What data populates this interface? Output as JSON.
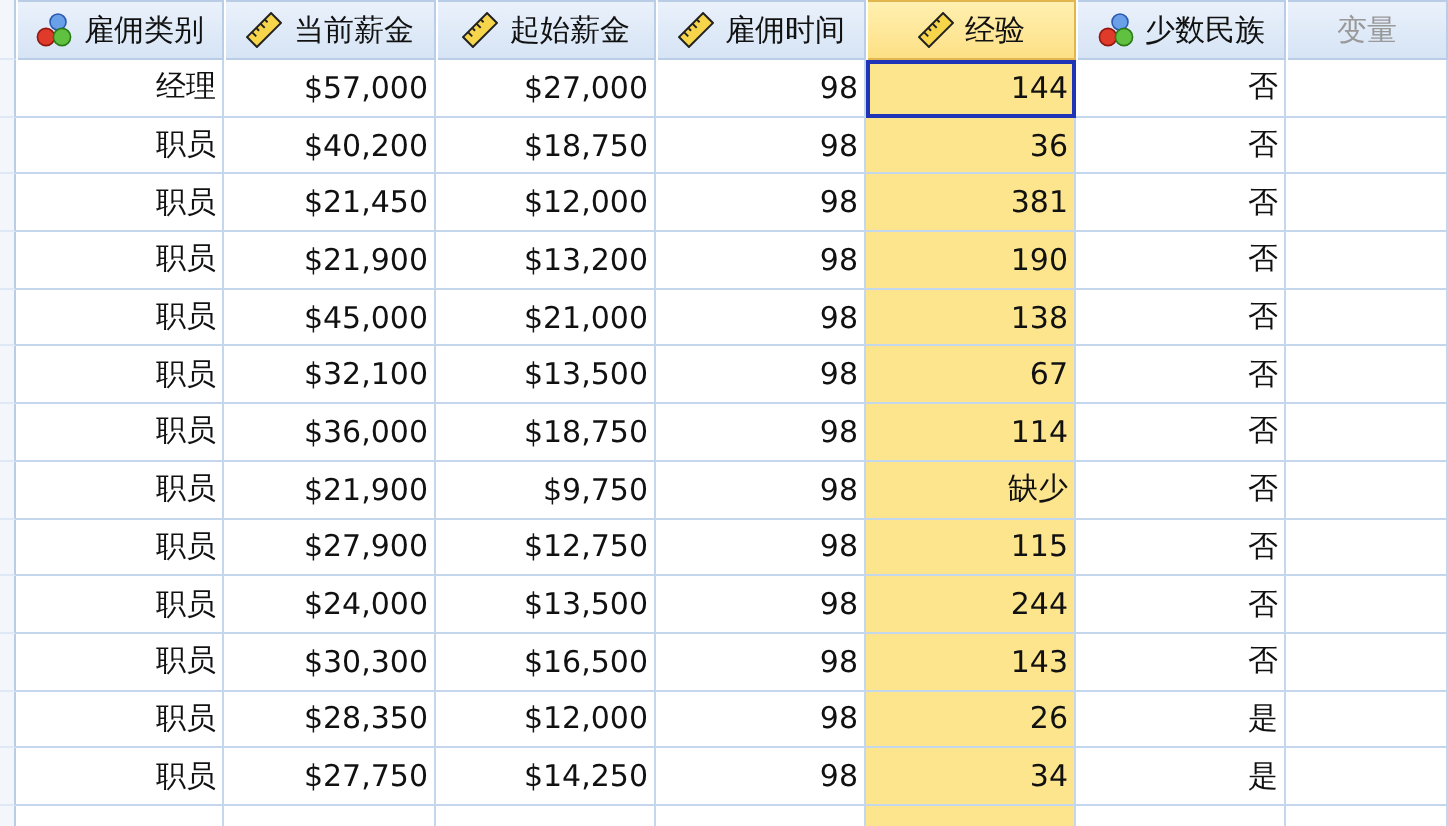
{
  "columns": [
    {
      "label": "雇佣类别",
      "kind": "nominal",
      "selected": false
    },
    {
      "label": "当前薪金",
      "kind": "scale",
      "selected": false
    },
    {
      "label": "起始薪金",
      "kind": "scale",
      "selected": false
    },
    {
      "label": "雇佣时间",
      "kind": "scale",
      "selected": false
    },
    {
      "label": "经验",
      "kind": "scale",
      "selected": true
    },
    {
      "label": "少数民族",
      "kind": "nominal",
      "selected": false
    },
    {
      "label": "变量",
      "kind": "empty",
      "selected": false
    }
  ],
  "rows": [
    {
      "focused": true,
      "cells": [
        "经理",
        "$57,000",
        "$27,000",
        "98",
        "144",
        "否"
      ]
    },
    {
      "focused": false,
      "cells": [
        "职员",
        "$40,200",
        "$18,750",
        "98",
        "36",
        "否"
      ]
    },
    {
      "focused": false,
      "cells": [
        "职员",
        "$21,450",
        "$12,000",
        "98",
        "381",
        "否"
      ]
    },
    {
      "focused": false,
      "cells": [
        "职员",
        "$21,900",
        "$13,200",
        "98",
        "190",
        "否"
      ]
    },
    {
      "focused": false,
      "cells": [
        "职员",
        "$45,000",
        "$21,000",
        "98",
        "138",
        "否"
      ]
    },
    {
      "focused": false,
      "cells": [
        "职员",
        "$32,100",
        "$13,500",
        "98",
        "67",
        "否"
      ]
    },
    {
      "focused": false,
      "cells": [
        "职员",
        "$36,000",
        "$18,750",
        "98",
        "114",
        "否"
      ]
    },
    {
      "focused": false,
      "cells": [
        "职员",
        "$21,900",
        "$9,750",
        "98",
        "缺少",
        "否"
      ]
    },
    {
      "focused": false,
      "cells": [
        "职员",
        "$27,900",
        "$12,750",
        "98",
        "115",
        "否"
      ]
    },
    {
      "focused": false,
      "cells": [
        "职员",
        "$24,000",
        "$13,500",
        "98",
        "244",
        "否"
      ]
    },
    {
      "focused": false,
      "cells": [
        "职员",
        "$30,300",
        "$16,500",
        "98",
        "143",
        "否"
      ]
    },
    {
      "focused": false,
      "cells": [
        "职员",
        "$28,350",
        "$12,000",
        "98",
        "26",
        "是"
      ]
    },
    {
      "focused": false,
      "cells": [
        "职员",
        "$27,750",
        "$14,250",
        "98",
        "34",
        "是"
      ]
    }
  ]
}
